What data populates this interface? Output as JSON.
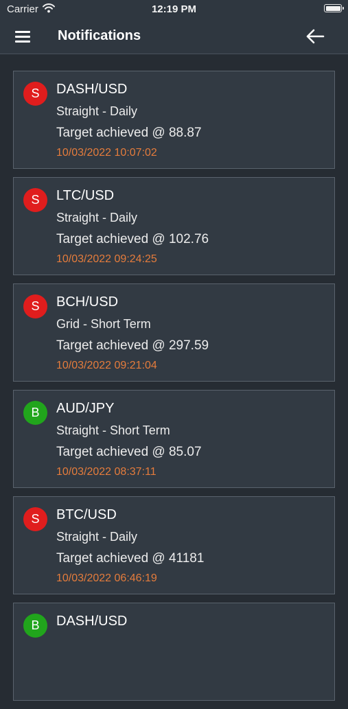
{
  "status_bar": {
    "carrier": "Carrier",
    "time": "12:19 PM"
  },
  "nav": {
    "title": "Notifications",
    "menu_icon": "hamburger-menu-icon",
    "back_icon": "arrow-left-icon"
  },
  "colors": {
    "background": "#262c33",
    "card": "#323a43",
    "sell_badge": "#e01d1d",
    "buy_badge": "#21a51c",
    "timestamp": "#e57c3c"
  },
  "notifications": [
    {
      "badge": "S",
      "type": "sell",
      "pair": "DASH/USD",
      "strategy": "Straight - Daily",
      "target": "Target achieved @ 88.87",
      "timestamp": "10/03/2022 10:07:02"
    },
    {
      "badge": "S",
      "type": "sell",
      "pair": "LTC/USD",
      "strategy": "Straight - Daily",
      "target": "Target achieved @ 102.76",
      "timestamp": "10/03/2022 09:24:25"
    },
    {
      "badge": "S",
      "type": "sell",
      "pair": "BCH/USD",
      "strategy": "Grid - Short Term",
      "target": "Target achieved @ 297.59",
      "timestamp": "10/03/2022 09:21:04"
    },
    {
      "badge": "B",
      "type": "buy",
      "pair": "AUD/JPY",
      "strategy": "Straight - Short Term",
      "target": "Target achieved @ 85.07",
      "timestamp": "10/03/2022 08:37:11"
    },
    {
      "badge": "S",
      "type": "sell",
      "pair": "BTC/USD",
      "strategy": "Straight - Daily",
      "target": "Target achieved @ 41181",
      "timestamp": "10/03/2022 06:46:19"
    },
    {
      "badge": "B",
      "type": "buy",
      "pair": "DASH/USD",
      "strategy": "",
      "target": "",
      "timestamp": ""
    }
  ]
}
